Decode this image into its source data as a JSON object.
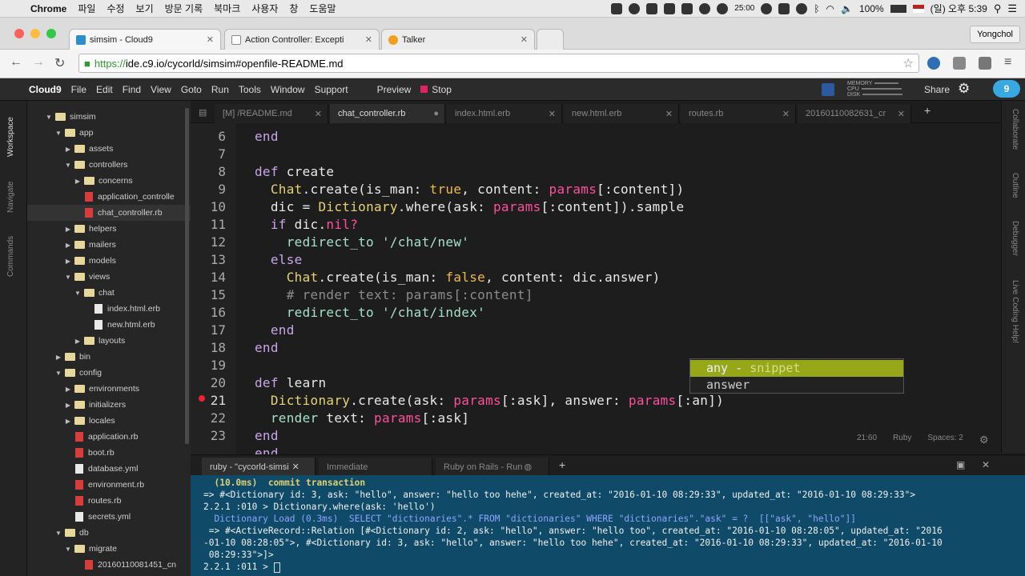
{
  "os_menubar": {
    "app": "Chrome",
    "items": [
      "파일",
      "수정",
      "보기",
      "방문 기록",
      "북마크",
      "사용자",
      "창",
      "도움말"
    ],
    "time_badge": "25:00",
    "battery": "100%",
    "datetime": "(일) 오후 5:39"
  },
  "browser": {
    "tabs": [
      {
        "title": "simsim - Cloud9",
        "active": true
      },
      {
        "title": "Action Controller: Excepti",
        "active": false
      },
      {
        "title": "Talker",
        "active": false
      }
    ],
    "profile": "Yongchol",
    "url_scheme": "https://",
    "url_rest": "ide.c9.io/cycorld/simsim#openfile-README.md"
  },
  "c9": {
    "logo": "Cloud9",
    "menu": [
      "File",
      "Edit",
      "Find",
      "View",
      "Goto",
      "Run",
      "Tools",
      "Window",
      "Support"
    ],
    "preview": "Preview",
    "stop": "Stop",
    "mem_labels": [
      "MEMORY",
      "CPU",
      "DISK"
    ],
    "share": "Share",
    "left_tabs": [
      "Workspace",
      "Navigate",
      "Commands"
    ],
    "right_tabs": [
      "Collaborate",
      "Outline",
      "Debugger",
      "Live Coding Help!"
    ]
  },
  "tree": [
    {
      "depth": 0,
      "type": "folder",
      "label": "simsim",
      "open": true
    },
    {
      "depth": 1,
      "type": "folder",
      "label": "app",
      "open": true
    },
    {
      "depth": 2,
      "type": "folder",
      "label": "assets",
      "open": false
    },
    {
      "depth": 2,
      "type": "folder",
      "label": "controllers",
      "open": true
    },
    {
      "depth": 3,
      "type": "folder",
      "label": "concerns",
      "open": false
    },
    {
      "depth": 3,
      "type": "rb",
      "label": "application_controlle"
    },
    {
      "depth": 3,
      "type": "rb",
      "label": "chat_controller.rb",
      "selected": true
    },
    {
      "depth": 2,
      "type": "folder",
      "label": "helpers",
      "open": false
    },
    {
      "depth": 2,
      "type": "folder",
      "label": "mailers",
      "open": false
    },
    {
      "depth": 2,
      "type": "folder",
      "label": "models",
      "open": false
    },
    {
      "depth": 2,
      "type": "folder",
      "label": "views",
      "open": true
    },
    {
      "depth": 3,
      "type": "folder",
      "label": "chat",
      "open": true
    },
    {
      "depth": 4,
      "type": "file",
      "label": "index.html.erb"
    },
    {
      "depth": 4,
      "type": "file",
      "label": "new.html.erb"
    },
    {
      "depth": 3,
      "type": "folder",
      "label": "layouts",
      "open": false
    },
    {
      "depth": 1,
      "type": "folder",
      "label": "bin",
      "open": false
    },
    {
      "depth": 1,
      "type": "folder",
      "label": "config",
      "open": true
    },
    {
      "depth": 2,
      "type": "folder",
      "label": "environments",
      "open": false
    },
    {
      "depth": 2,
      "type": "folder",
      "label": "initializers",
      "open": false
    },
    {
      "depth": 2,
      "type": "folder",
      "label": "locales",
      "open": false
    },
    {
      "depth": 2,
      "type": "rb",
      "label": "application.rb"
    },
    {
      "depth": 2,
      "type": "rb",
      "label": "boot.rb"
    },
    {
      "depth": 2,
      "type": "file",
      "label": "database.yml"
    },
    {
      "depth": 2,
      "type": "rb",
      "label": "environment.rb"
    },
    {
      "depth": 2,
      "type": "rb",
      "label": "routes.rb"
    },
    {
      "depth": 2,
      "type": "file",
      "label": "secrets.yml"
    },
    {
      "depth": 1,
      "type": "folder",
      "label": "db",
      "open": true
    },
    {
      "depth": 2,
      "type": "folder",
      "label": "migrate",
      "open": true
    },
    {
      "depth": 3,
      "type": "rb",
      "label": "20160110081451_cn"
    }
  ],
  "editor_tabs": [
    {
      "label": "[M] /README.md",
      "active": false
    },
    {
      "label": "chat_controller.rb",
      "active": true
    },
    {
      "label": "index.html.erb",
      "active": false
    },
    {
      "label": "new.html.erb",
      "active": false
    },
    {
      "label": "routes.rb",
      "active": false
    },
    {
      "label": "20160110082631_cr",
      "active": false
    }
  ],
  "code": {
    "line_numbers": [
      "6",
      "7",
      "8",
      "9",
      "10",
      "11",
      "12",
      "13",
      "14",
      "15",
      "16",
      "17",
      "18",
      "19",
      "20",
      "21",
      "22",
      "23"
    ],
    "error_line": "21"
  },
  "autocomplete": {
    "items": [
      {
        "text": "any",
        "meta": "snippet"
      },
      {
        "text": "answer",
        "meta": ""
      }
    ]
  },
  "editor_status": {
    "position": "21:60",
    "mode": "Ruby",
    "spaces": "Spaces: 2"
  },
  "console_tabs": [
    {
      "label": "ruby - \"cycorld-simsi",
      "active": true
    },
    {
      "label": "Immediate",
      "active": false
    },
    {
      "label": "Ruby on Rails - Run",
      "active": false
    }
  ],
  "console_lines": [
    "  (10.0ms)  commit transaction",
    "=> #<Dictionary id: 3, ask: \"hello\", answer: \"hello too hehe\", created_at: \"2016-01-10 08:29:33\", updated_at: \"2016-01-10 08:29:33\">",
    "2.2.1 :010 > Dictionary.where(ask: 'hello')",
    "  Dictionary Load (0.3ms)  SELECT \"dictionaries\".* FROM \"dictionaries\" WHERE \"dictionaries\".\"ask\" = ?  [[\"ask\", \"hello\"]]",
    " => #<ActiveRecord::Relation [#<Dictionary id: 2, ask: \"hello\", answer: \"hello too\", created_at: \"2016-01-10 08:28:05\", updated_at: \"2016",
    "-01-10 08:28:05\">, #<Dictionary id: 3, ask: \"hello\", answer: \"hello too hehe\", created_at: \"2016-01-10 08:29:33\", updated_at: \"2016-01-10",
    " 08:29:33\">]>",
    "2.2.1 :011 > "
  ]
}
